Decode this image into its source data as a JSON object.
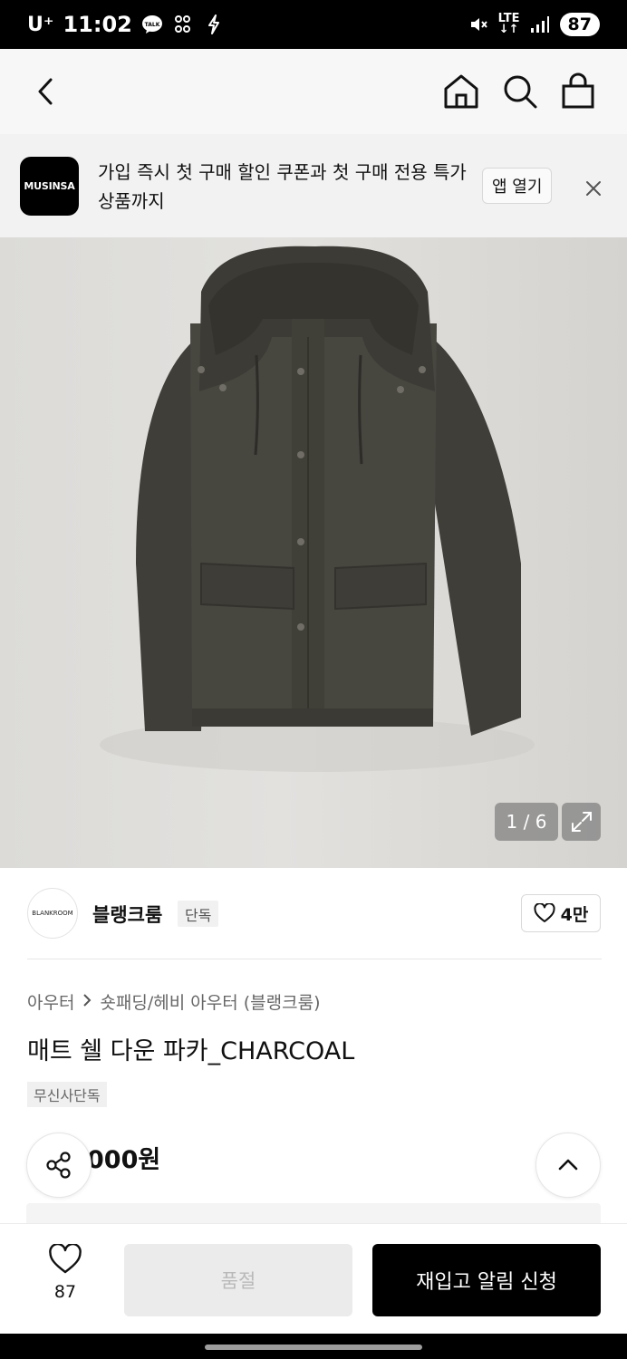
{
  "status_bar": {
    "carrier": "U⁺",
    "time": "11:02",
    "talk_badge": "TALK",
    "lte": "LTE",
    "battery": "87"
  },
  "nav": {
    "icons": [
      "back-icon",
      "home-icon",
      "search-icon",
      "cart-icon"
    ]
  },
  "app_banner": {
    "logo_text": "MUSINSA",
    "message": "가입 즉시 첫 구매 할인 쿠폰과 첫 구매 전용 특가 상품까지",
    "open_label": "앱 열기"
  },
  "gallery": {
    "counter": "1 / 6"
  },
  "brand": {
    "avatar_text": "BLANKROOM",
    "name": "블랭크룸",
    "tag": "단독",
    "like_count": "4만"
  },
  "product": {
    "breadcrumb_category": "아우터",
    "breadcrumb_sub": "숏패딩/헤비 아우터 (블랭크룸)",
    "title": "매트 쉘 다운 파카_CHARCOAL",
    "badge": "무신사단독",
    "price": "000원"
  },
  "bottom_bar": {
    "wish_count": "87",
    "soldout_label": "품절",
    "restock_label": "재입고 알림 신청"
  },
  "colors": {
    "primary": "#000000",
    "banner_bg": "#f2f2f2",
    "nav_bg": "#f7f7f7",
    "disabled_bg": "#ebebeb",
    "disabled_text": "#b9b9b9"
  }
}
